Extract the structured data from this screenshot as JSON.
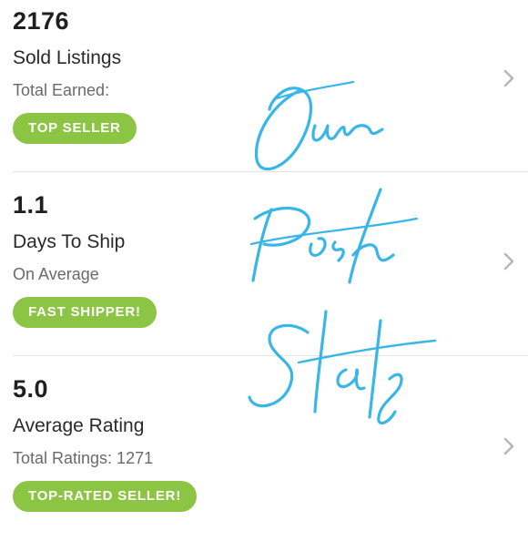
{
  "stats": [
    {
      "value": "2176",
      "title": "Sold Listings",
      "subtitle": "Total Earned:",
      "badge": "TOP SELLER"
    },
    {
      "value": "1.1",
      "title": "Days To Ship",
      "subtitle": "On Average",
      "badge": "FAST SHIPPER!"
    },
    {
      "value": "5.0",
      "title": "Average Rating",
      "subtitle": "Total Ratings: 1271",
      "badge": "TOP-RATED SELLER!"
    }
  ],
  "overlay": {
    "lines": [
      "Our",
      "Posh",
      "Stats"
    ],
    "color": "#38b6e8"
  },
  "colors": {
    "badge": "#8cc444",
    "chevron": "#b5b5b5",
    "divider": "#e6e6e6"
  },
  "icons": {
    "row_arrow": "chevron-right-icon"
  }
}
